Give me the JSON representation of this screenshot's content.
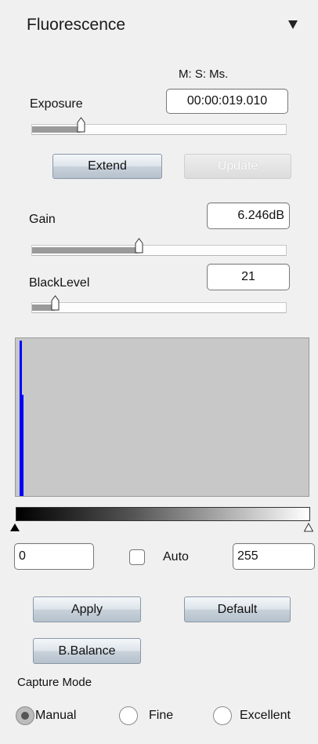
{
  "panel": {
    "title": "Fluorescence"
  },
  "exposure": {
    "label": "Exposure",
    "time_format": "M: S:  Ms.",
    "value": "00:00:019.010",
    "slider_fraction": 0.19,
    "extend_label": "Extend",
    "update_label": "Update"
  },
  "gain": {
    "label": "Gain",
    "value": "6.246dB",
    "slider_fraction": 0.42
  },
  "black_level": {
    "label": "BlackLevel",
    "value": "21",
    "slider_fraction": 0.09
  },
  "histogram": {
    "range_min": "0",
    "range_max": "255",
    "auto_label": "Auto",
    "auto_checked": false,
    "bar_color": "#0000ff",
    "bg_color": "#c8c8c8"
  },
  "buttons": {
    "apply": "Apply",
    "default": "Default",
    "balance": "B.Balance"
  },
  "capture_mode": {
    "label": "Capture Mode",
    "options": [
      {
        "label": "Manual",
        "checked": true
      },
      {
        "label": "Fine",
        "checked": false
      },
      {
        "label": "Excellent",
        "checked": false
      }
    ]
  }
}
